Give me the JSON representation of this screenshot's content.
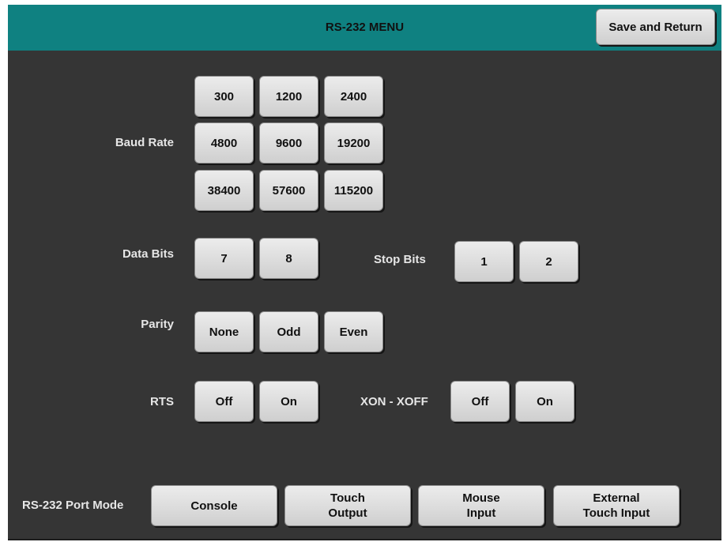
{
  "header": {
    "title": "RS-232 MENU",
    "save_return_label": "Save and Return"
  },
  "baud_rate": {
    "label": "Baud Rate",
    "options": [
      "300",
      "1200",
      "2400",
      "4800",
      "9600",
      "19200",
      "38400",
      "57600",
      "115200"
    ]
  },
  "data_bits": {
    "label": "Data Bits",
    "options": [
      "7",
      "8"
    ]
  },
  "stop_bits": {
    "label": "Stop Bits",
    "options": [
      "1",
      "2"
    ]
  },
  "parity": {
    "label": "Parity",
    "options": [
      "None",
      "Odd",
      "Even"
    ]
  },
  "rts": {
    "label": "RTS",
    "options": [
      "Off",
      "On"
    ]
  },
  "xon_xoff": {
    "label": "XON - XOFF",
    "options": [
      "Off",
      "On"
    ]
  },
  "port_mode": {
    "label": "RS-232 Port Mode",
    "options": [
      {
        "line1": "Console",
        "line2": ""
      },
      {
        "line1": "Touch",
        "line2": "Output"
      },
      {
        "line1": "Mouse",
        "line2": "Input"
      },
      {
        "line1": "External",
        "line2": "Touch Input"
      }
    ]
  }
}
